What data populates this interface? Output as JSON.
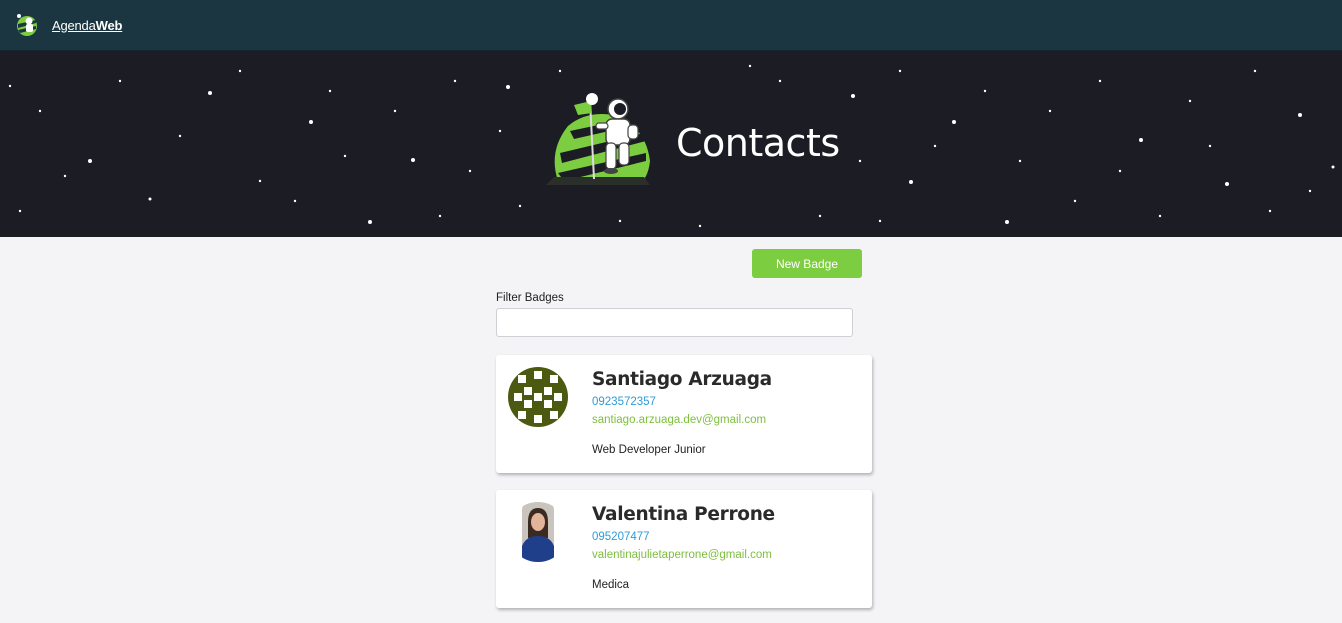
{
  "navbar": {
    "brand_light": "Agenda",
    "brand_bold": "Web"
  },
  "hero": {
    "title": "Contacts"
  },
  "actions": {
    "new_badge_label": "New Badge"
  },
  "filter": {
    "label": "Filter Badges",
    "value": "",
    "placeholder": ""
  },
  "badges": [
    {
      "name": "Santiago Arzuaga",
      "phone": "0923572357",
      "email": "santiago.arzuaga.dev@gmail.com",
      "job": "Web Developer Junior",
      "avatar": "identicon-avatar"
    },
    {
      "name": "Valentina Perrone",
      "phone": "095207477",
      "email": "valentinajulietaperrone@gmail.com",
      "job": "Medica",
      "avatar": "photo-avatar"
    }
  ],
  "colors": {
    "navbar": "#1b3640",
    "hero": "#1c1c24",
    "accent_green": "#7dcd40",
    "phone_blue": "#2f9bd6",
    "email_green": "#7dbf3d",
    "background": "#f4f4f6"
  }
}
